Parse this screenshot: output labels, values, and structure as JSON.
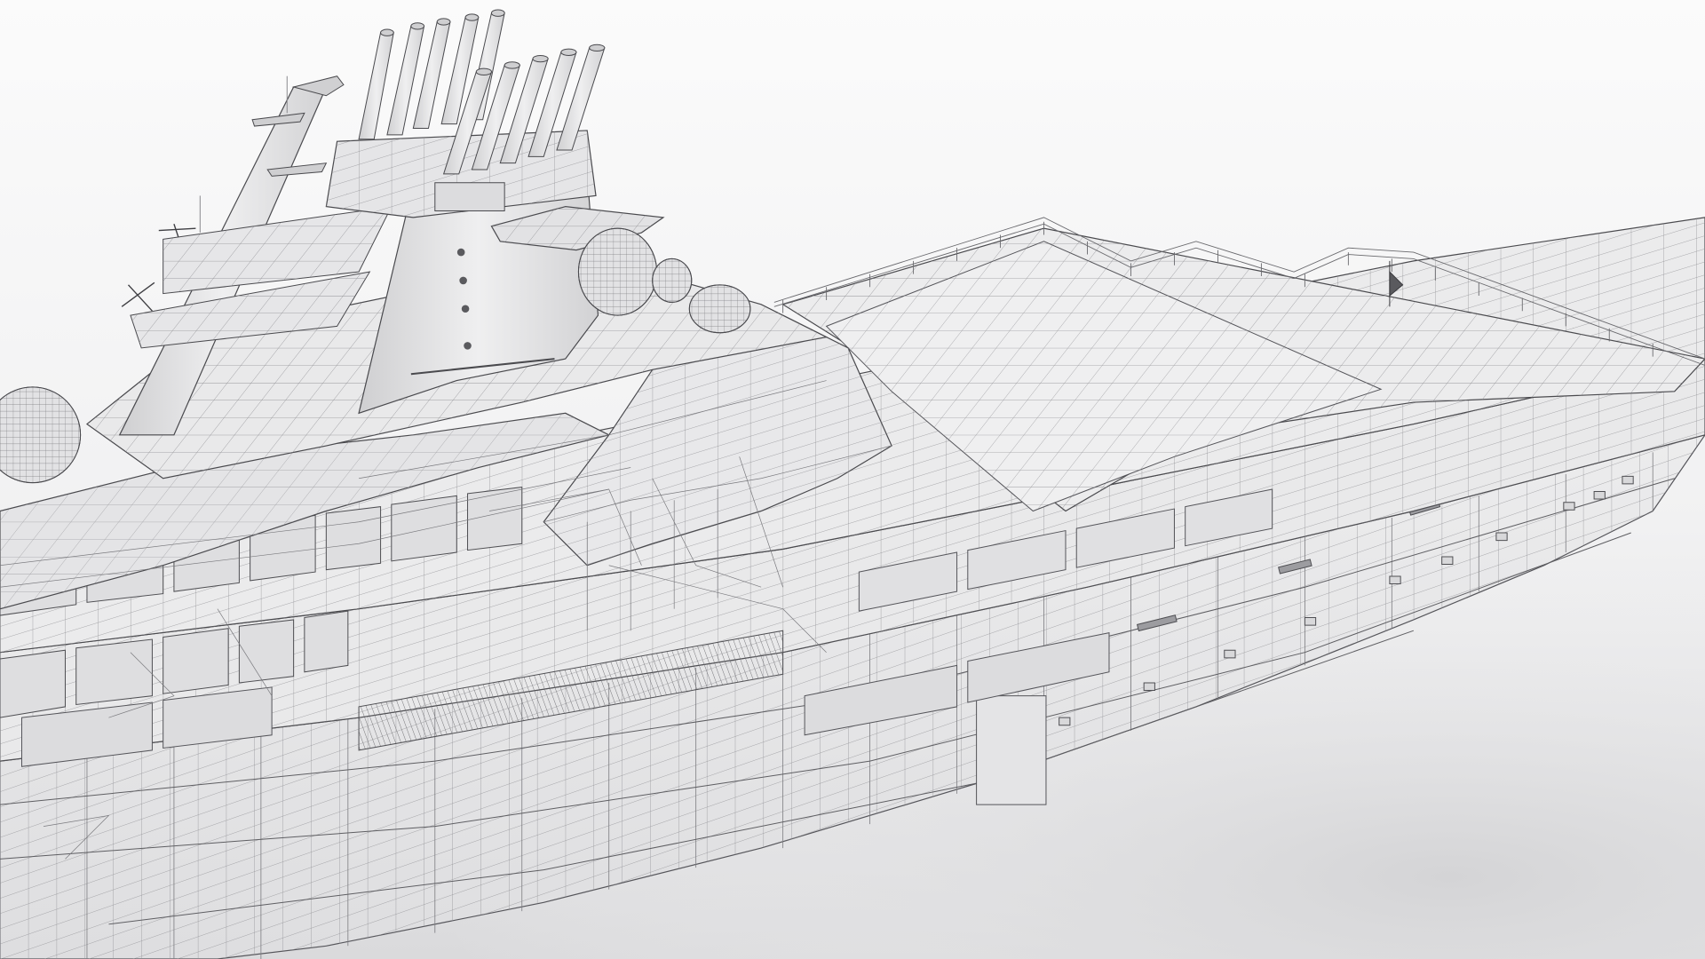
{
  "scene": {
    "colors": {
      "background_top": "#fafafa",
      "background_bottom": "#dcdcde",
      "surface": "#e7e7e8",
      "surface_light": "#efeff0",
      "surface_dark": "#d4d4d6",
      "wire": "#6e6e72",
      "wire_light": "#9a9a9e",
      "outline": "#4a4a4e"
    }
  }
}
